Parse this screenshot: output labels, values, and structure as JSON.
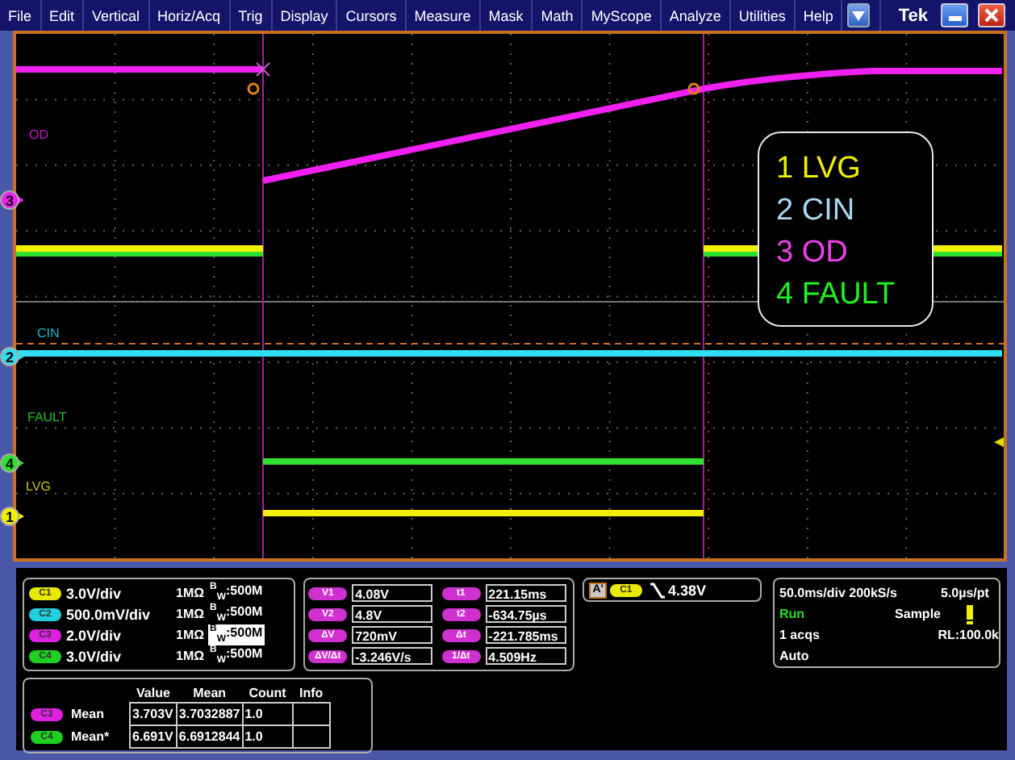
{
  "menu": {
    "items": [
      "File",
      "Edit",
      "Vertical",
      "Horiz/Acq",
      "Trig",
      "Display",
      "Cursors",
      "Measure",
      "Mask",
      "Math",
      "MyScope",
      "Analyze",
      "Utilities",
      "Help"
    ],
    "brand": "Tek"
  },
  "scope": {
    "labels": [
      {
        "text": "OD",
        "color": "#c020c0"
      },
      {
        "text": "CIN",
        "color": "#20b8c8"
      },
      {
        "text": "FAULT",
        "color": "#20c020"
      },
      {
        "text": "LVG",
        "color": "#c8c800"
      }
    ],
    "markers": [
      {
        "number": "3",
        "color": "#f020f0"
      },
      {
        "number": "2",
        "color": "#30e0f0"
      },
      {
        "number": "4",
        "color": "#30e030"
      },
      {
        "number": "1",
        "color": "#f0f000"
      }
    ],
    "legend": [
      {
        "text": "1 LVG",
        "color": "#f0f000"
      },
      {
        "text": "2 CIN",
        "color": "#a8d8f0"
      },
      {
        "text": "3 OD",
        "color": "#f040f0"
      },
      {
        "text": "4 FAULT",
        "color": "#20f020"
      }
    ]
  },
  "channels": [
    {
      "badge": "C1",
      "color": "#e8e800",
      "scale": "3.0V/div",
      "impedance": "1MΩ",
      "bandwidth": "$^{B}$$_{W}$:500M",
      "selected": false
    },
    {
      "badge": "C2",
      "color": "#20d0e0",
      "scale": "500.0mV/div",
      "impedance": "1MΩ",
      "bandwidth": "$^{B}$$_{W}$:500M",
      "selected": false
    },
    {
      "badge": "C3",
      "color": "#e020e0",
      "scale": "2.0V/div",
      "impedance": "1MΩ",
      "bandwidth": "$^{B}$$_{W}$:500M",
      "selected": true
    },
    {
      "badge": "C4",
      "color": "#20d020",
      "scale": "3.0V/div",
      "impedance": "1MΩ",
      "bandwidth": "$^{B}$$_{W}$:500M",
      "selected": false
    }
  ],
  "cursors": [
    {
      "badge": "V1",
      "value": "4.08V"
    },
    {
      "badge": "V2",
      "value": "4.8V"
    },
    {
      "badge": "ΔV",
      "value": "720mV"
    },
    {
      "badge": "ΔV/Δt",
      "value": "-3.246V/s"
    },
    {
      "badge": "t1",
      "value": "221.15ms"
    },
    {
      "badge": "t2",
      "value": "-634.75µs"
    },
    {
      "badge": "Δt",
      "value": "-221.785ms"
    },
    {
      "badge": "1/Δt",
      "value": "4.509Hz"
    }
  ],
  "trigger": {
    "badge": "A'",
    "source": "C1",
    "level": "4.38V"
  },
  "acquisition": {
    "timebase": "50.0ms/div 200kS/s",
    "resolution": "5.0µs/pt",
    "state": "Run",
    "mode": "Sample",
    "acqs": "1 acqs",
    "record_length": "RL:100.0k",
    "trigger_mode": "Auto"
  },
  "measurements": {
    "columns": [
      "Value",
      "Mean",
      "Count",
      "Info"
    ],
    "rows": [
      {
        "badge": "C3",
        "color": "#e020e0",
        "label": "Mean",
        "value": "3.703V",
        "mean": "3.7032887",
        "count": "1.0"
      },
      {
        "badge": "C4",
        "color": "#20d020",
        "label": "Mean*",
        "value": "6.691V",
        "mean": "6.6912844",
        "count": "1.0"
      }
    ]
  }
}
